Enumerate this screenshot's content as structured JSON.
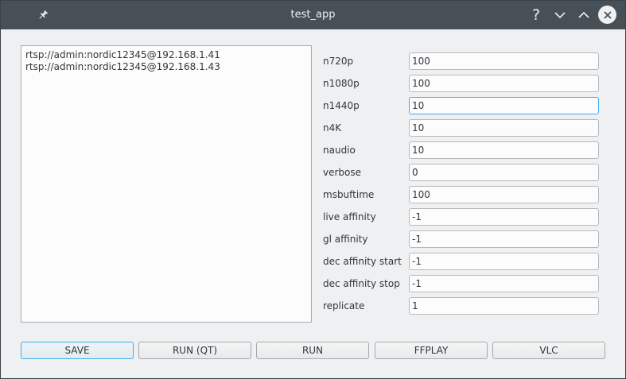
{
  "window": {
    "title": "test_app"
  },
  "titlebar": {
    "pin_icon": "pin-icon",
    "help_label": "?",
    "minimize_icon": "chevron-down-icon",
    "maximize_icon": "chevron-up-icon",
    "close_icon": "close-icon"
  },
  "urls": [
    "rtsp://admin:nordic12345@192.168.1.41",
    "rtsp://admin:nordic12345@192.168.1.43"
  ],
  "params": [
    {
      "label": "n720p",
      "value": "100"
    },
    {
      "label": "n1080p",
      "value": "100"
    },
    {
      "label": "n1440p",
      "value": "10"
    },
    {
      "label": "n4K",
      "value": "10"
    },
    {
      "label": "naudio",
      "value": "10"
    },
    {
      "label": "verbose",
      "value": "0"
    },
    {
      "label": "msbuftime",
      "value": "100"
    },
    {
      "label": "live affinity",
      "value": "-1"
    },
    {
      "label": "gl affinity",
      "value": "-1"
    },
    {
      "label": "dec affinity start",
      "value": "-1"
    },
    {
      "label": "dec affinity stop",
      "value": "-1"
    },
    {
      "label": "replicate",
      "value": "1"
    }
  ],
  "buttons": {
    "save": "SAVE",
    "run_qt": "RUN (QT)",
    "run": "RUN",
    "ffplay": "FFPLAY",
    "vlc": "VLC"
  },
  "colors": {
    "titlebar": "#475057",
    "window_bg": "#eff0f1",
    "accent": "#3daee9"
  }
}
